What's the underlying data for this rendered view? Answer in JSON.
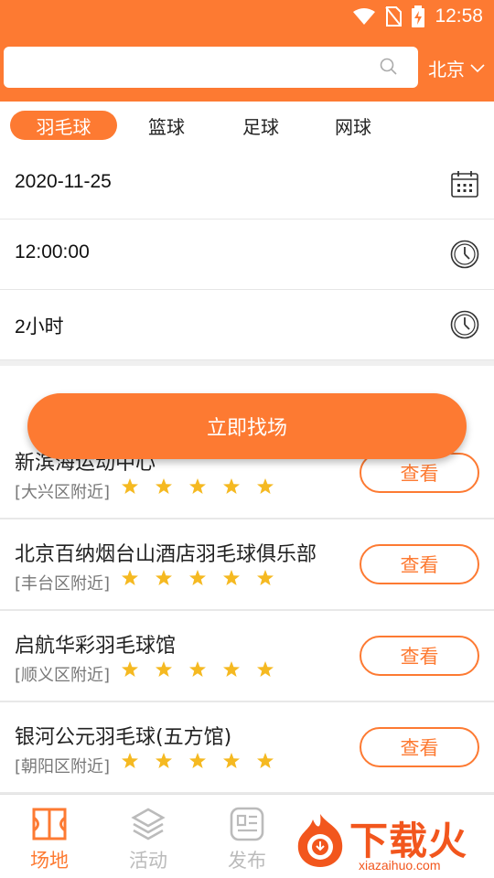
{
  "status_bar": {
    "time": "12:58"
  },
  "search": {
    "value": "",
    "placeholder": ""
  },
  "city": {
    "label": "北京"
  },
  "sport_tabs": [
    {
      "label": "羽毛球",
      "active": true
    },
    {
      "label": "篮球",
      "active": false
    },
    {
      "label": "足球",
      "active": false
    },
    {
      "label": "网球",
      "active": false
    }
  ],
  "form": {
    "date": "2020-11-25",
    "time": "12:00:00",
    "duration": "2小时"
  },
  "find_button": {
    "label": "立即找场"
  },
  "venues": [
    {
      "name": "新滨海运动中心",
      "area": "[大兴区附近]",
      "rating": 5,
      "button": "查看"
    },
    {
      "name": "北京百纳烟台山酒店羽毛球俱乐部",
      "area": "[丰台区附近]",
      "rating": 5,
      "button": "查看"
    },
    {
      "name": "启航华彩羽毛球馆",
      "area": "[顺义区附近]",
      "rating": 5,
      "button": "查看"
    },
    {
      "name": "银河公元羽毛球(五方馆)",
      "area": "[朝阳区附近]",
      "rating": 5,
      "button": "查看"
    }
  ],
  "bottom_nav": [
    {
      "label": "场地",
      "icon": "venue-icon",
      "active": true
    },
    {
      "label": "活动",
      "icon": "layers-icon",
      "active": false
    },
    {
      "label": "发布",
      "icon": "publish-icon",
      "active": false
    }
  ],
  "watermark": {
    "title": "下载火",
    "subtitle": "xiazaihuo.com"
  },
  "colors": {
    "accent": "#fd7a32",
    "star": "#f5b921",
    "muted": "#bbbbbb"
  }
}
